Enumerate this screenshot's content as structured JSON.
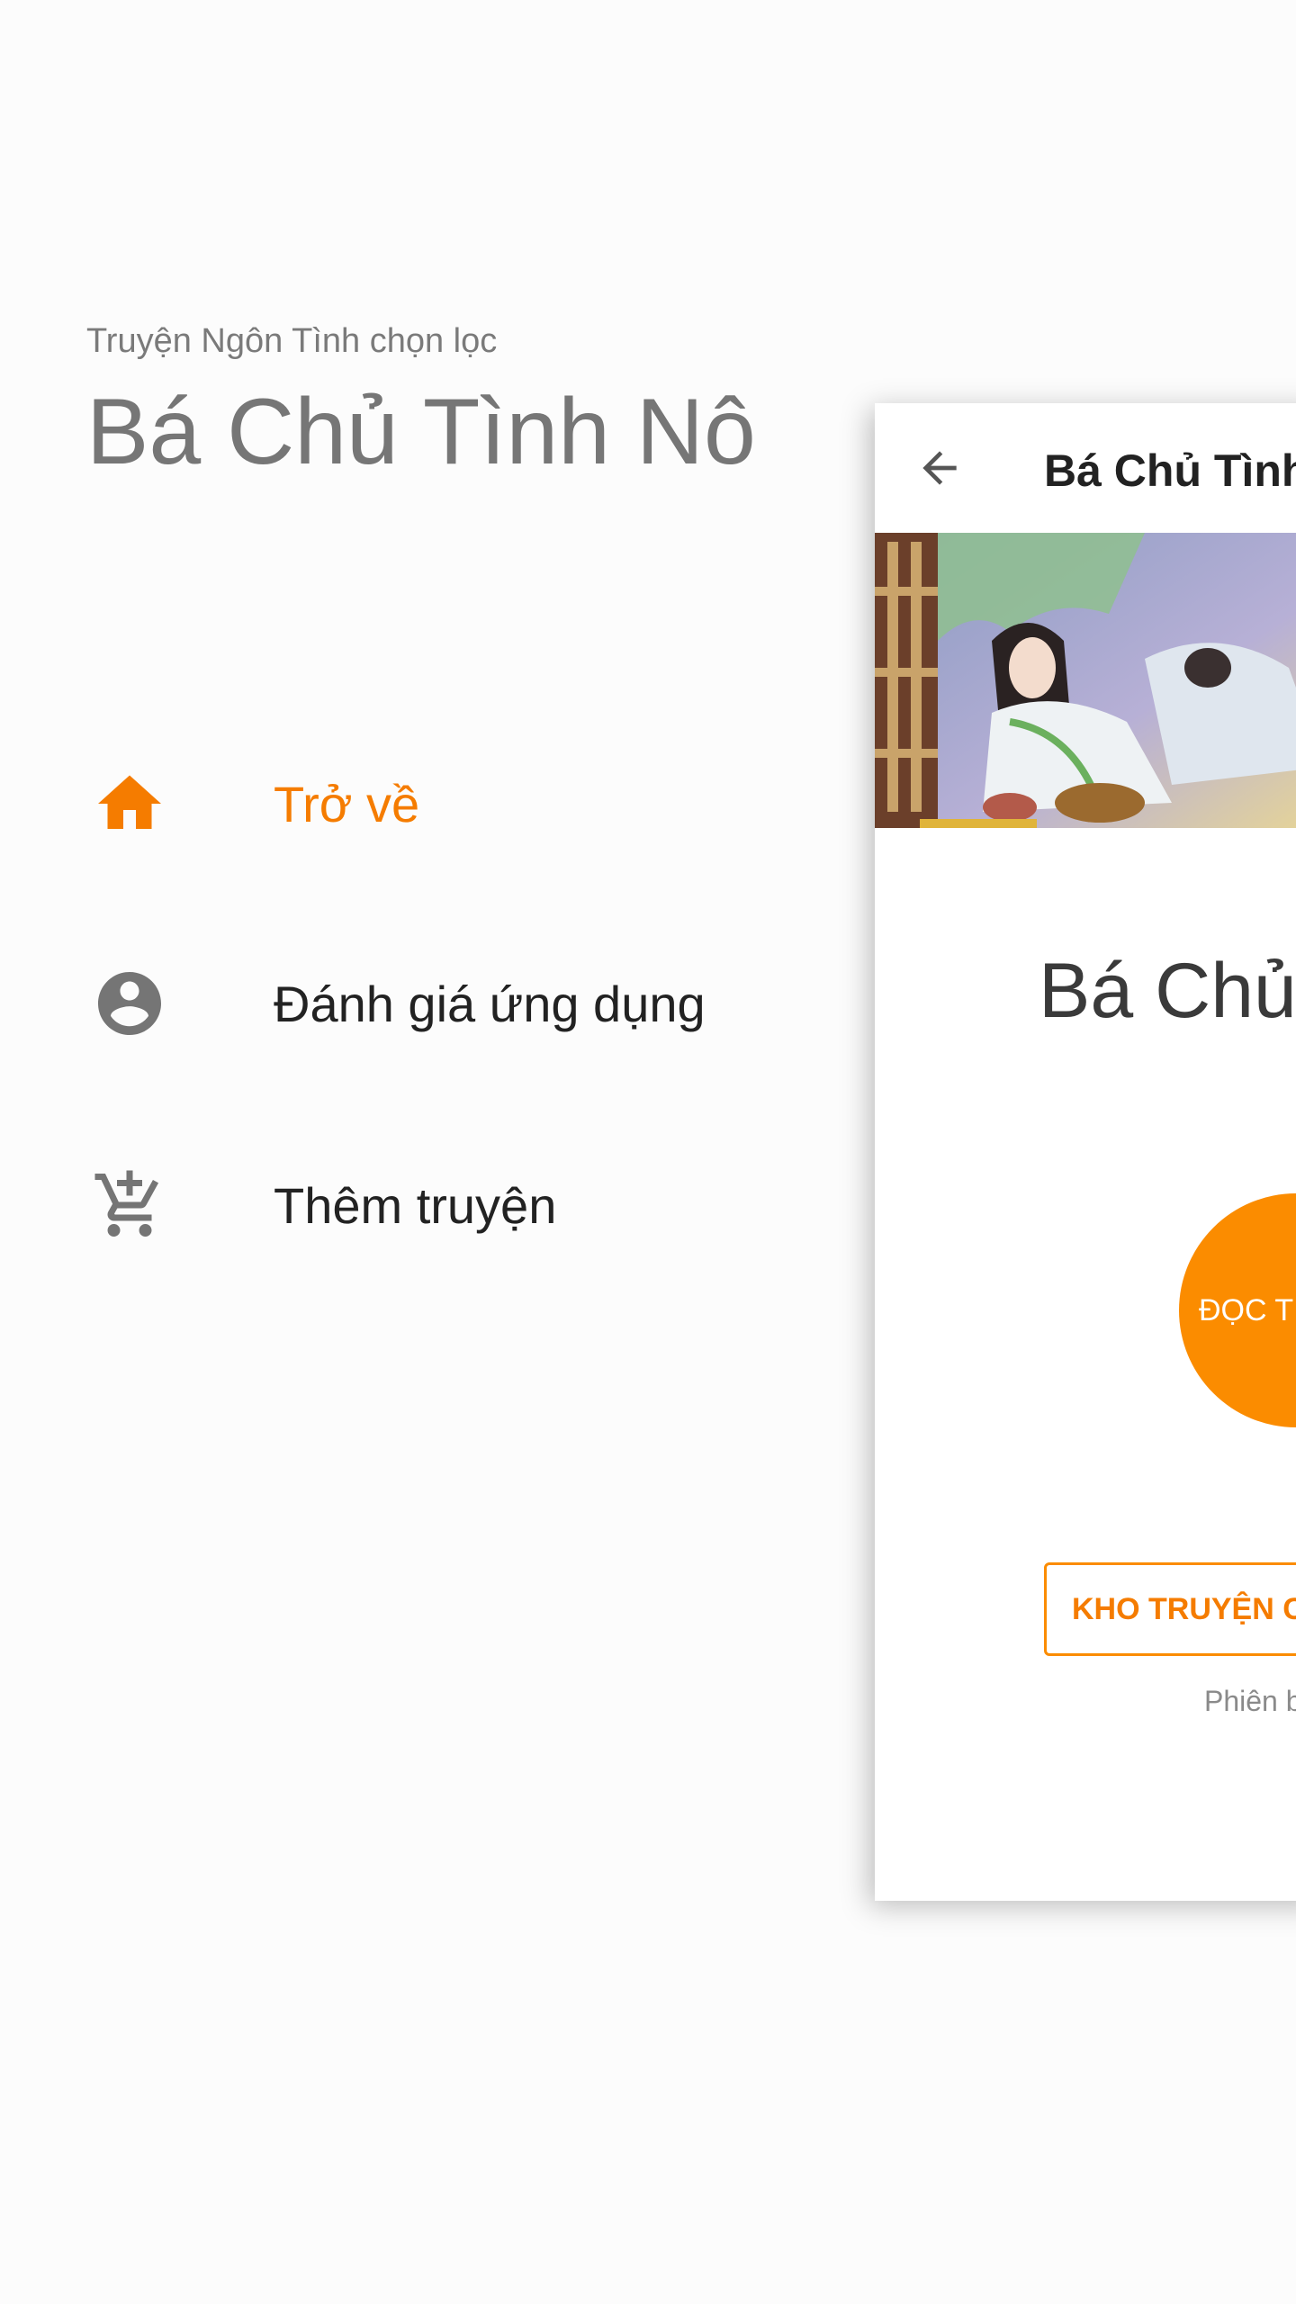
{
  "drawer": {
    "subtitle": "Truyện Ngôn Tình chọn lọc",
    "title": "Bá Chủ Tình Nô",
    "items": [
      {
        "label": "Trở về",
        "icon": "home-icon",
        "active": true
      },
      {
        "label": "Đánh giá ứng dụng",
        "icon": "account-circle-icon",
        "active": false
      },
      {
        "label": "Thêm truyện",
        "icon": "add-cart-icon",
        "active": false
      }
    ]
  },
  "main": {
    "appbar": {
      "title": "Bá Chủ Tình",
      "back_icon": "arrow-back-icon"
    },
    "cover_image": "book-cover-illustration",
    "story_name": "Bá Chủ",
    "read_button_label": "ĐỌC TI",
    "store_button_label": "KHO TRUYỆN C",
    "version_text": "Phiên b"
  },
  "colors": {
    "accent": "#f57c00",
    "accent_fill": "#fb8c00",
    "icon_grey": "#757575",
    "text_dark": "#222222"
  }
}
